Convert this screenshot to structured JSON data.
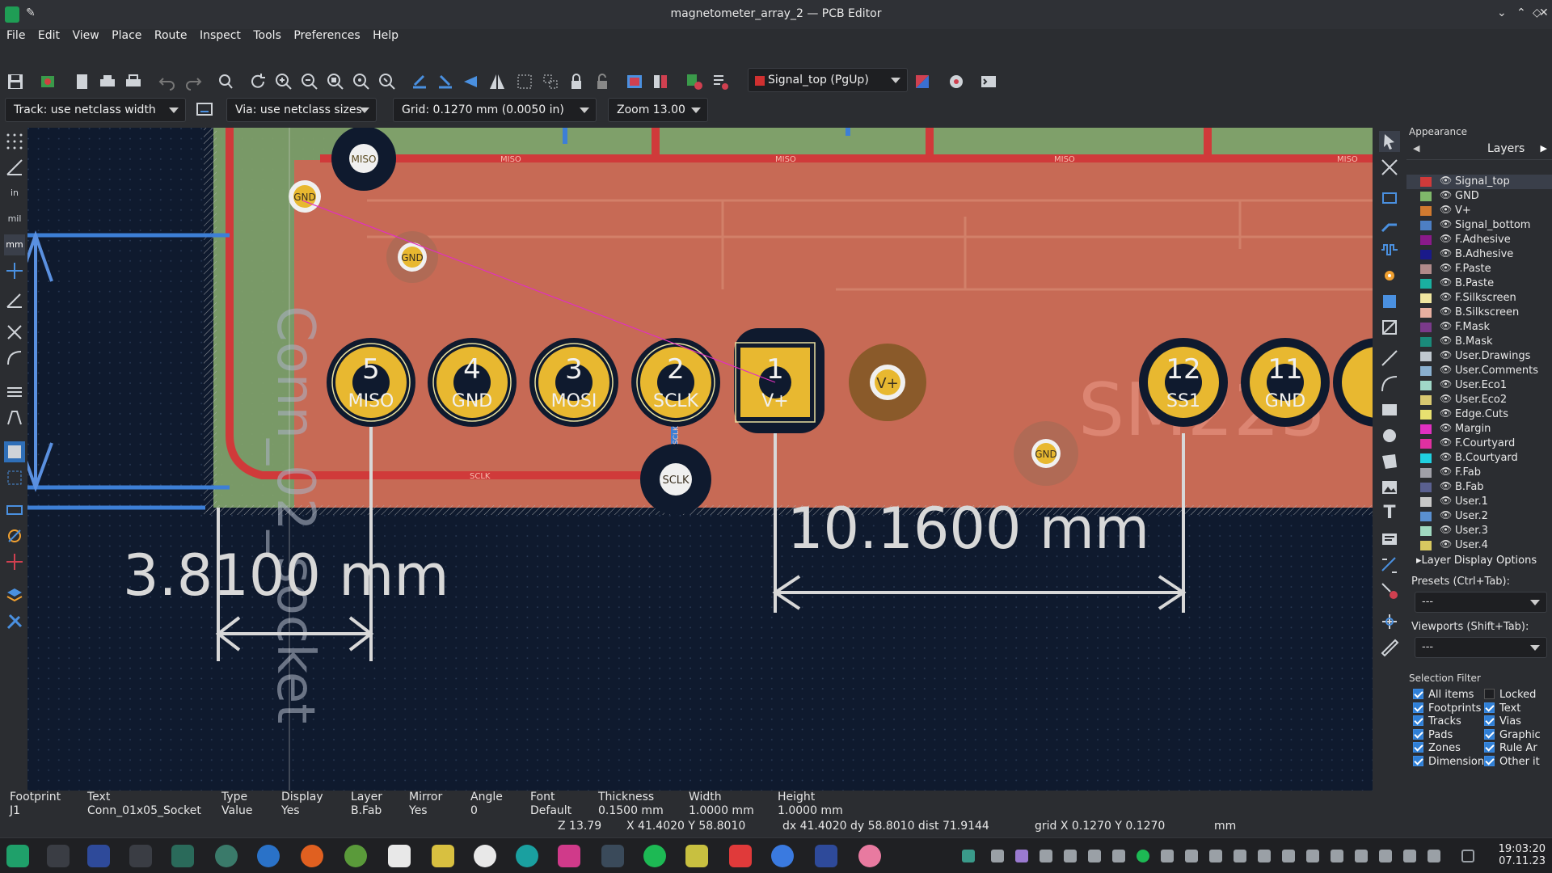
{
  "window": {
    "title": "magnetometer_array_2 — PCB Editor"
  },
  "menu": [
    "File",
    "Edit",
    "View",
    "Place",
    "Route",
    "Inspect",
    "Tools",
    "Preferences",
    "Help"
  ],
  "toolbar": {
    "active_layer": "Signal_top (PgUp)",
    "track_width": "Track: use netclass width",
    "via_size": "Via: use netclass sizes",
    "grid": "Grid: 0.1270 mm (0.0050 in)",
    "zoom": "Zoom 13.00"
  },
  "canvas": {
    "pads_left": [
      {
        "num": "5",
        "net": "MISO"
      },
      {
        "num": "4",
        "net": "GND"
      },
      {
        "num": "3",
        "net": "MOSI"
      },
      {
        "num": "2",
        "net": "SCLK"
      },
      {
        "num": "1",
        "net": "V+"
      }
    ],
    "pads_right": [
      {
        "num": "12",
        "net": "SS1"
      },
      {
        "num": "11",
        "net": "GND"
      }
    ],
    "via_labels": {
      "miso": "MISO",
      "gnd1": "GND",
      "gnd2": "GND",
      "vplus": "V+",
      "sclk": "SCLK",
      "gnd3": "GND"
    },
    "track_labels": {
      "miso": "MISO",
      "sclk": "SCLK",
      "sclk_v": "SCLK"
    },
    "silk_text": "Conn_02_socket",
    "ref_text": "SM225",
    "dim_left": "3.8100 mm",
    "dim_right": "10.1600 mm"
  },
  "appearance": {
    "title": "Appearance",
    "tab": "Layers",
    "layers": [
      {
        "name": "Signal_top",
        "color": "#d03a3a"
      },
      {
        "name": "GND",
        "color": "#7fb86a"
      },
      {
        "name": "V+",
        "color": "#d07a30"
      },
      {
        "name": "Signal_bottom",
        "color": "#4d7fc4"
      },
      {
        "name": "F.Adhesive",
        "color": "#8a1a8a"
      },
      {
        "name": "B.Adhesive",
        "color": "#1a1a8a"
      },
      {
        "name": "F.Paste",
        "color": "#b08a8a"
      },
      {
        "name": "B.Paste",
        "color": "#1ab0a0"
      },
      {
        "name": "F.Silkscreen",
        "color": "#f0e6a0"
      },
      {
        "name": "B.Silkscreen",
        "color": "#e8b0a0"
      },
      {
        "name": "F.Mask",
        "color": "#7a3a8a"
      },
      {
        "name": "B.Mask",
        "color": "#1a8a7a"
      },
      {
        "name": "User.Drawings",
        "color": "#c0c8d0"
      },
      {
        "name": "User.Comments",
        "color": "#8ab0d0"
      },
      {
        "name": "User.Eco1",
        "color": "#a0d8c8"
      },
      {
        "name": "User.Eco2",
        "color": "#d8c870"
      },
      {
        "name": "Edge.Cuts",
        "color": "#e8e070"
      },
      {
        "name": "Margin",
        "color": "#e030c0"
      },
      {
        "name": "F.Courtyard",
        "color": "#e030a0"
      },
      {
        "name": "B.Courtyard",
        "color": "#20d0e0"
      },
      {
        "name": "F.Fab",
        "color": "#a0a0a8"
      },
      {
        "name": "B.Fab",
        "color": "#5a6090"
      },
      {
        "name": "User.1",
        "color": "#c8c8c8"
      },
      {
        "name": "User.2",
        "color": "#5a90d0"
      },
      {
        "name": "User.3",
        "color": "#a0d8c0"
      },
      {
        "name": "User.4",
        "color": "#d8c860"
      }
    ],
    "layer_display_options": "Layer Display Options",
    "presets_label": "Presets (Ctrl+Tab):",
    "presets_value": "---",
    "viewports_label": "Viewports (Shift+Tab):",
    "viewports_value": "---",
    "selection_filter_title": "Selection Filter",
    "filters_left": [
      "All items",
      "Footprints",
      "Tracks",
      "Pads",
      "Zones",
      "Dimensions"
    ],
    "filters_right": [
      {
        "label": "Locked",
        "checked": false
      },
      {
        "label": "Text",
        "checked": true
      },
      {
        "label": "Vias",
        "checked": true
      },
      {
        "label": "Graphic",
        "checked": true
      },
      {
        "label": "Rule Ar",
        "checked": true
      },
      {
        "label": "Other it",
        "checked": true
      }
    ]
  },
  "msgpanel": [
    {
      "head": "Footprint",
      "val": "J1"
    },
    {
      "head": "Text",
      "val": "Conn_01x05_Socket"
    },
    {
      "head": "Type",
      "val": "Value"
    },
    {
      "head": "Display",
      "val": "Yes"
    },
    {
      "head": "Layer",
      "val": "B.Fab"
    },
    {
      "head": "Mirror",
      "val": "Yes"
    },
    {
      "head": "Angle",
      "val": "0"
    },
    {
      "head": "Font",
      "val": "Default"
    },
    {
      "head": "Thickness",
      "val": "0.1500 mm"
    },
    {
      "head": "Width",
      "val": "1.0000 mm"
    },
    {
      "head": "Height",
      "val": "1.0000 mm"
    }
  ],
  "status": {
    "zoom": "Z 13.79",
    "pos": "X 41.4020  Y 58.8010",
    "delta": "dx 41.4020  dy 58.8010  dist 71.9144",
    "grid": "grid X 0.1270  Y 0.1270",
    "units": "mm"
  },
  "clock": {
    "time": "19:03:20",
    "date": "07.11.23"
  }
}
